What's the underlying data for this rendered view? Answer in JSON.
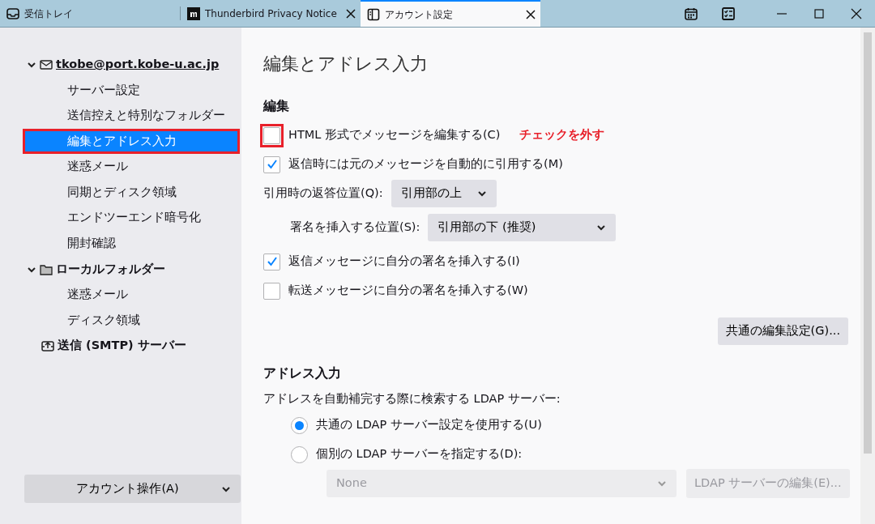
{
  "tabs": [
    {
      "kind": "inbox",
      "label": "受信トレイ",
      "selected": false
    },
    {
      "kind": "web",
      "label": "Thunderbird Privacy Notice",
      "selected": false
    },
    {
      "kind": "settings",
      "label": "アカウント設定",
      "selected": true
    }
  ],
  "sidebar": {
    "accounts": [
      {
        "kind": "mail",
        "label": "tkobe@port.kobe-u.ac.jp",
        "expanded": true,
        "children": [
          {
            "label": "サーバー設定",
            "selected": false,
            "annotated": false
          },
          {
            "label": "送信控えと特別なフォルダー",
            "selected": false,
            "annotated": false
          },
          {
            "label": "編集とアドレス入力",
            "selected": true,
            "annotated": true
          },
          {
            "label": "迷惑メール",
            "selected": false,
            "annotated": false
          },
          {
            "label": "同期とディスク領域",
            "selected": false,
            "annotated": false
          },
          {
            "label": "エンドツーエンド暗号化",
            "selected": false,
            "annotated": false
          },
          {
            "label": "開封確認",
            "selected": false,
            "annotated": false
          }
        ]
      },
      {
        "kind": "folder",
        "label": "ローカルフォルダー",
        "expanded": true,
        "children": [
          {
            "label": "迷惑メール",
            "selected": false,
            "annotated": false
          },
          {
            "label": "ディスク領域",
            "selected": false,
            "annotated": false
          }
        ]
      },
      {
        "kind": "smtp",
        "label": "送信 (SMTP) サーバー"
      }
    ],
    "account_actions": "アカウント操作(A)"
  },
  "page_title": "編集とアドレス入力",
  "sections": [
    {
      "heading": "編集",
      "rows": [
        {
          "kind": "checkbox",
          "label": "HTML 形式でメッセージを編集する(C)",
          "checked": false,
          "annotated": true,
          "annotation": "チェックを外す"
        },
        {
          "kind": "checkbox",
          "label": "返信時には元のメッセージを自動的に引用する(M)",
          "checked": true,
          "annotated": false
        },
        {
          "kind": "select",
          "label": "引用時の返答位置(Q):",
          "value": "引用部の上",
          "children": [
            {
              "kind": "select",
              "label": "署名を挿入する位置(S):",
              "value": "引用部の下 (推奨)"
            }
          ]
        },
        {
          "kind": "checkbox",
          "label": "返信メッセージに自分の署名を挿入する(I)",
          "checked": true,
          "annotated": false
        },
        {
          "kind": "checkbox",
          "label": "転送メッセージに自分の署名を挿入する(W)",
          "checked": false,
          "annotated": false
        },
        {
          "kind": "button",
          "label": "共通の編集設定(G)..."
        }
      ]
    },
    {
      "heading": "アドレス入力",
      "rows": [
        {
          "kind": "text",
          "label": "アドレスを自動補完する際に検索する LDAP サーバー:"
        },
        {
          "kind": "radio",
          "label": "共通の LDAP サーバー設定を使用する(U)",
          "selected": true
        },
        {
          "kind": "radio",
          "label": "個別の LDAP サーバーを指定する(D):",
          "selected": false
        },
        {
          "kind": "select_button",
          "value": "None",
          "button": "LDAP サーバーの編集(E)...",
          "disabled": true
        }
      ]
    }
  ]
}
